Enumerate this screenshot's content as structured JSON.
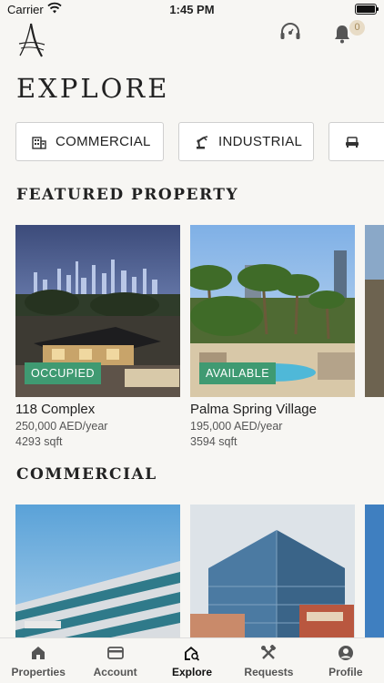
{
  "status_bar": {
    "carrier": "Carrier",
    "time": "1:45 PM"
  },
  "header": {
    "notification_count": "0"
  },
  "page_title": "EXPLORE",
  "categories": [
    {
      "label": "COMMERCIAL",
      "icon": "building-icon"
    },
    {
      "label": "INDUSTRIAL",
      "icon": "robot-arm-icon"
    },
    {
      "label": "",
      "icon": "sofa-icon"
    }
  ],
  "featured": {
    "title": "FEATURED PROPERTY",
    "items": [
      {
        "name": "118 Complex",
        "price": "250,000 AED/year",
        "area": "4293 sqft",
        "status": "OCCUPIED",
        "status_color": "#3f9a72"
      },
      {
        "name": "Palma Spring Village",
        "price": "195,000 AED/year",
        "area": "3594 sqft",
        "status": "AVAILABLE",
        "status_color": "#3f9a72"
      }
    ]
  },
  "commercial": {
    "title": "COMMERCIAL"
  },
  "tabs": [
    {
      "label": "Properties",
      "icon": "home-icon",
      "active": false
    },
    {
      "label": "Account",
      "icon": "card-icon",
      "active": false
    },
    {
      "label": "Explore",
      "icon": "explore-home-icon",
      "active": true
    },
    {
      "label": "Requests",
      "icon": "tools-icon",
      "active": false
    },
    {
      "label": "Profile",
      "icon": "person-icon",
      "active": false
    }
  ],
  "colors": {
    "accent_green": "#3f9a72",
    "badge_bg": "#e8dcc6",
    "badge_text": "#a58b5c",
    "background": "#f7f6f3"
  }
}
